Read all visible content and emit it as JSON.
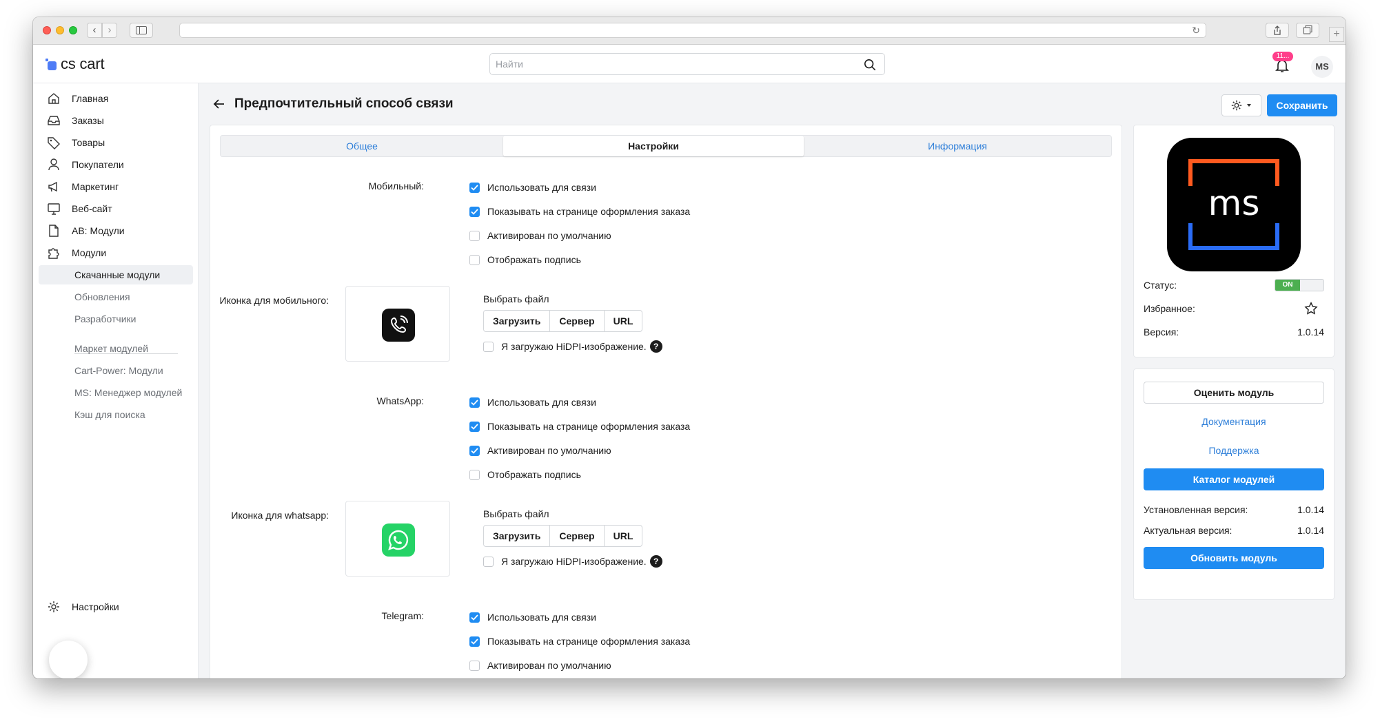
{
  "header": {
    "logo_text": "cs cart",
    "search_placeholder": "Найти",
    "notifications_badge": "11...",
    "avatar_initials": "MS"
  },
  "sidebar": {
    "items": [
      {
        "label": "Главная",
        "icon": "home-icon"
      },
      {
        "label": "Заказы",
        "icon": "inbox-icon"
      },
      {
        "label": "Товары",
        "icon": "tag-icon"
      },
      {
        "label": "Покупатели",
        "icon": "user-icon"
      },
      {
        "label": "Маркетинг",
        "icon": "megaphone-icon"
      },
      {
        "label": "Веб-сайт",
        "icon": "monitor-icon"
      },
      {
        "label": "AB: Модули",
        "icon": "document-icon"
      },
      {
        "label": "Модули",
        "icon": "puzzle-icon"
      }
    ],
    "subitems": [
      {
        "label": "Скачанные модули",
        "active": true
      },
      {
        "label": "Обновления",
        "active": false
      },
      {
        "label": "Разработчики",
        "active": false
      }
    ],
    "subitems2": [
      {
        "label": "Маркет модулей"
      },
      {
        "label": "Cart-Power: Модули"
      },
      {
        "label": "MS: Менеджер модулей"
      },
      {
        "label": "Кэш для поиска"
      }
    ],
    "settings_label": "Настройки"
  },
  "page": {
    "title": "Предпочтительный способ связи",
    "save_label": "Сохранить"
  },
  "tabs": [
    {
      "label": "Общее",
      "active": false
    },
    {
      "label": "Настройки",
      "active": true
    },
    {
      "label": "Информация",
      "active": false
    }
  ],
  "sections": {
    "mobile": {
      "label": "Мобильный:",
      "options": [
        {
          "label": "Использовать для связи",
          "checked": true
        },
        {
          "label": "Показывать на странице оформления заказа",
          "checked": true
        },
        {
          "label": "Активирован по умолчанию",
          "checked": false
        },
        {
          "label": "Отображать подпись",
          "checked": false
        }
      ],
      "icon_label": "Иконка для мобильного:"
    },
    "whatsapp": {
      "label": "WhatsApp:",
      "options": [
        {
          "label": "Использовать для связи",
          "checked": true
        },
        {
          "label": "Показывать на странице оформления заказа",
          "checked": true
        },
        {
          "label": "Активирован по умолчанию",
          "checked": true
        },
        {
          "label": "Отображать подпись",
          "checked": false
        }
      ],
      "icon_label": "Иконка для whatsapp:"
    },
    "telegram": {
      "label": "Telegram:",
      "options": [
        {
          "label": "Использовать для связи",
          "checked": true
        },
        {
          "label": "Показывать на странице оформления заказа",
          "checked": true
        },
        {
          "label": "Активирован по умолчанию",
          "checked": false
        }
      ]
    }
  },
  "file_picker": {
    "choose_label": "Выбрать файл",
    "buttons": [
      "Загрузить",
      "Сервер",
      "URL"
    ],
    "hidpi_label": "Я загружаю HiDPI-изображение.",
    "help": "?"
  },
  "module_card": {
    "logo_text": "ms",
    "status_label": "Статус:",
    "status_value": "ON",
    "favorite_label": "Избранное:",
    "version_label": "Версия:",
    "version_value": "1.0.14"
  },
  "actions_card": {
    "rate_label": "Оценить модуль",
    "docs_label": "Документация",
    "support_label": "Поддержка",
    "catalog_label": "Каталог модулей",
    "installed_label": "Установленная версия:",
    "installed_value": "1.0.14",
    "actual_label": "Актуальная версия:",
    "actual_value": "1.0.14",
    "update_label": "Обновить модуль"
  },
  "colors": {
    "primary": "#1f8cf2",
    "link": "#2e7fd9",
    "toggle_on": "#4caf50",
    "badge": "#ff3e8a",
    "ms_orange": "#ff5a1f",
    "ms_blue": "#2a6cf6",
    "whatsapp_green": "#25d366"
  }
}
